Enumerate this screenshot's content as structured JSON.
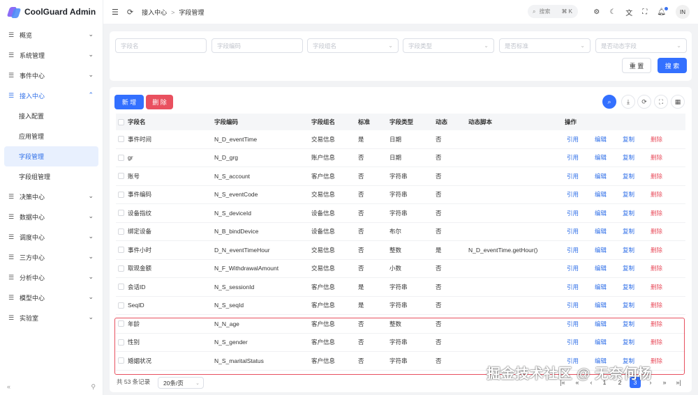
{
  "app": {
    "title": "CoolGuard Admin"
  },
  "sidebar": {
    "items": [
      {
        "label": "概览"
      },
      {
        "label": "系统管理"
      },
      {
        "label": "事件中心"
      },
      {
        "label": "接入中心",
        "open": true,
        "children": [
          {
            "label": "接入配置"
          },
          {
            "label": "应用管理"
          },
          {
            "label": "字段管理",
            "active": true
          },
          {
            "label": "字段组管理"
          }
        ]
      },
      {
        "label": "决策中心"
      },
      {
        "label": "数据中心"
      },
      {
        "label": "调度中心"
      },
      {
        "label": "三方中心"
      },
      {
        "label": "分析中心"
      },
      {
        "label": "模型中心"
      },
      {
        "label": "实验室"
      }
    ],
    "collapse_glyph": "«",
    "pin_glyph": "⚲"
  },
  "topbar": {
    "breadcrumb": [
      "接入中心",
      "字段管理"
    ],
    "search_label": "搜索",
    "search_shortcut": "⌘ K",
    "avatar_text": "IN"
  },
  "filters": {
    "placeholders": [
      "字段名",
      "字段编码",
      "字段组名",
      "字段类型",
      "是否标准",
      "是否动态字段"
    ],
    "reset_label": "重 置",
    "search_label": "搜 索"
  },
  "toolbar": {
    "add_label": "新 增",
    "delete_label": "删 除"
  },
  "table": {
    "headers": [
      "字段名",
      "字段编码",
      "字段组名",
      "标准",
      "字段类型",
      "动态",
      "动态脚本",
      "操作"
    ],
    "actions": [
      "引用",
      "编辑",
      "复制",
      "删除"
    ],
    "rows": [
      [
        "事件时间",
        "N_D_eventTime",
        "交易信息",
        "是",
        "日期",
        "否",
        ""
      ],
      [
        "gr",
        "N_D_grg",
        "账户信息",
        "否",
        "日期",
        "否",
        ""
      ],
      [
        "账号",
        "N_S_account",
        "客户信息",
        "否",
        "字符串",
        "否",
        ""
      ],
      [
        "事件编码",
        "N_S_eventCode",
        "交易信息",
        "否",
        "字符串",
        "否",
        ""
      ],
      [
        "设备指纹",
        "N_S_deviceId",
        "设备信息",
        "否",
        "字符串",
        "否",
        ""
      ],
      [
        "绑定设备",
        "N_B_bindDevice",
        "设备信息",
        "否",
        "布尔",
        "否",
        ""
      ],
      [
        "事件小时",
        "D_N_eventTimeHour",
        "交易信息",
        "否",
        "整数",
        "是",
        "N_D_eventTime.getHour()"
      ],
      [
        "取现金额",
        "N_F_WithdrawalAmount",
        "交易信息",
        "否",
        "小数",
        "否",
        ""
      ],
      [
        "会话ID",
        "N_S_sessionId",
        "客户信息",
        "是",
        "字符串",
        "否",
        ""
      ],
      [
        "SeqID",
        "N_S_seqId",
        "客户信息",
        "是",
        "字符串",
        "否",
        ""
      ],
      [
        "年龄",
        "N_N_age",
        "客户信息",
        "否",
        "整数",
        "否",
        ""
      ],
      [
        "性别",
        "N_S_gender",
        "客户信息",
        "否",
        "字符串",
        "否",
        ""
      ],
      [
        "婚姻状况",
        "N_S_maritalStatus",
        "客户信息",
        "否",
        "字符串",
        "否",
        ""
      ]
    ]
  },
  "pagination": {
    "total_text": "共 53 条记录",
    "page_size": "20条/页",
    "pages": [
      "1",
      "2",
      "3"
    ],
    "current": "3"
  },
  "watermark": "掘金技术社区 @ 无奈何杨",
  "colors": {
    "primary": "#3370ff",
    "danger": "#e9505f",
    "highlight": "#e8505f"
  }
}
